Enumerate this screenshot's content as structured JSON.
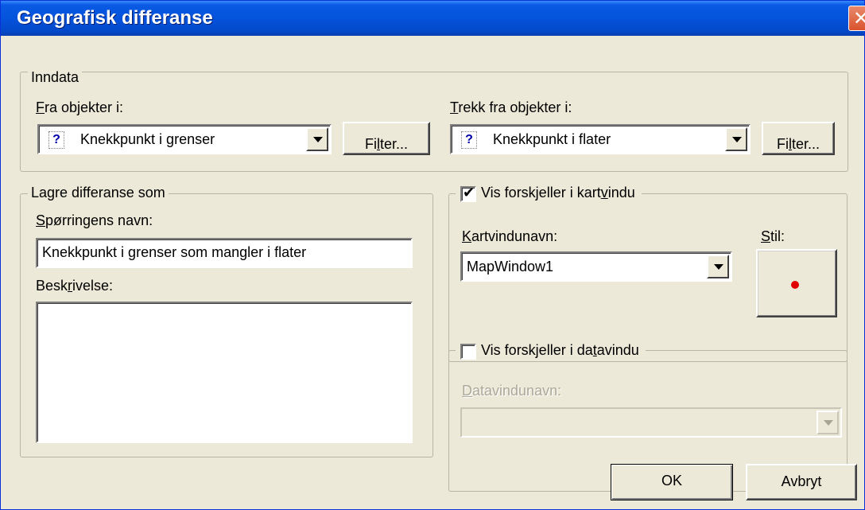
{
  "window": {
    "title": "Geografisk differanse"
  },
  "input_group": {
    "legend": "Inndata",
    "from_label_first": "F",
    "from_label_rest": "ra objekter i:",
    "from_value": "Knekkpunkt i grenser",
    "from_filter_first": "Fi",
    "from_filter_ul": "l",
    "from_filter_rest": "ter...",
    "subtract_label_first": "T",
    "subtract_label_rest": "rekk fra objekter i:",
    "subtract_value": "Knekkpunkt i flater",
    "subtract_filter_first": "Fi",
    "subtract_filter_ul": "l",
    "subtract_filter_rest": "ter..."
  },
  "save_group": {
    "legend": "Lagre differanse som",
    "query_label_first": "S",
    "query_label_rest": "pørringens navn:",
    "query_value": "Knekkpunkt i grenser som mangler i flater",
    "description_label_first": "Besk",
    "description_label_ul": "r",
    "description_label_rest": "ivelse:",
    "description_value": ""
  },
  "map_group": {
    "checkbox_checked": true,
    "checkbox_label_first": "Vis forskjeller i kart",
    "checkbox_label_ul": "v",
    "checkbox_label_rest": "indu",
    "mapname_label_first": "K",
    "mapname_label_rest": "artvindunavn:",
    "mapname_value": "MapWindow1",
    "style_label_first": "S",
    "style_label_rest": "til:",
    "style_color": "#e00000"
  },
  "data_group": {
    "checkbox_checked": false,
    "checkbox_label_first": "Vis forskjeller i da",
    "checkbox_label_ul": "t",
    "checkbox_label_rest": "avindu",
    "dataname_label_first": "D",
    "dataname_label_rest": "atavindunavn:",
    "dataname_value": ""
  },
  "buttons": {
    "ok": "OK",
    "cancel": "Avbryt"
  },
  "icons": {
    "close": "close-icon",
    "query": "question-icon",
    "checkmark": "checkmark-icon"
  }
}
